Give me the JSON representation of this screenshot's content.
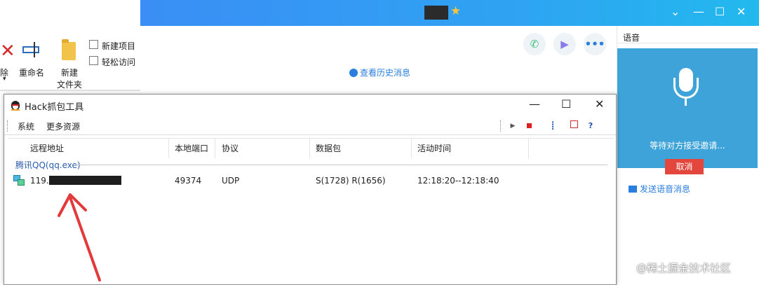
{
  "explorer": {
    "delete_label": "除",
    "rename_label": "重命名",
    "new_folder_line1": "新建",
    "new_folder_line2": "文件夹",
    "new_item_label": "新建项目",
    "easy_access_label": "轻松访问"
  },
  "qq_window": {
    "history_link": "查看历史消息",
    "icons": [
      "phone-icon",
      "video-icon",
      "more-icon"
    ],
    "voice_tab": "语音",
    "voice_waiting": "等待对方接受邀请...",
    "cancel_button": "取消",
    "send_voice_message": "发送语音消息",
    "accent_color": "#2fa3f2"
  },
  "hack_tool": {
    "title": "Hack抓包工具",
    "menu": [
      "系统",
      "更多资源"
    ],
    "columns": [
      "远程地址",
      "本地端口",
      "协议",
      "数据包",
      "活动时间"
    ],
    "group": "腾讯QQ(qq.exe)",
    "rows": [
      {
        "remote_address": "119.",
        "local_port": "49374",
        "protocol": "UDP",
        "packets": "S(1728) R(1656)",
        "active_time": "12:18:20--12:18:40"
      }
    ]
  },
  "watermark": "@稀土掘金技术社区"
}
